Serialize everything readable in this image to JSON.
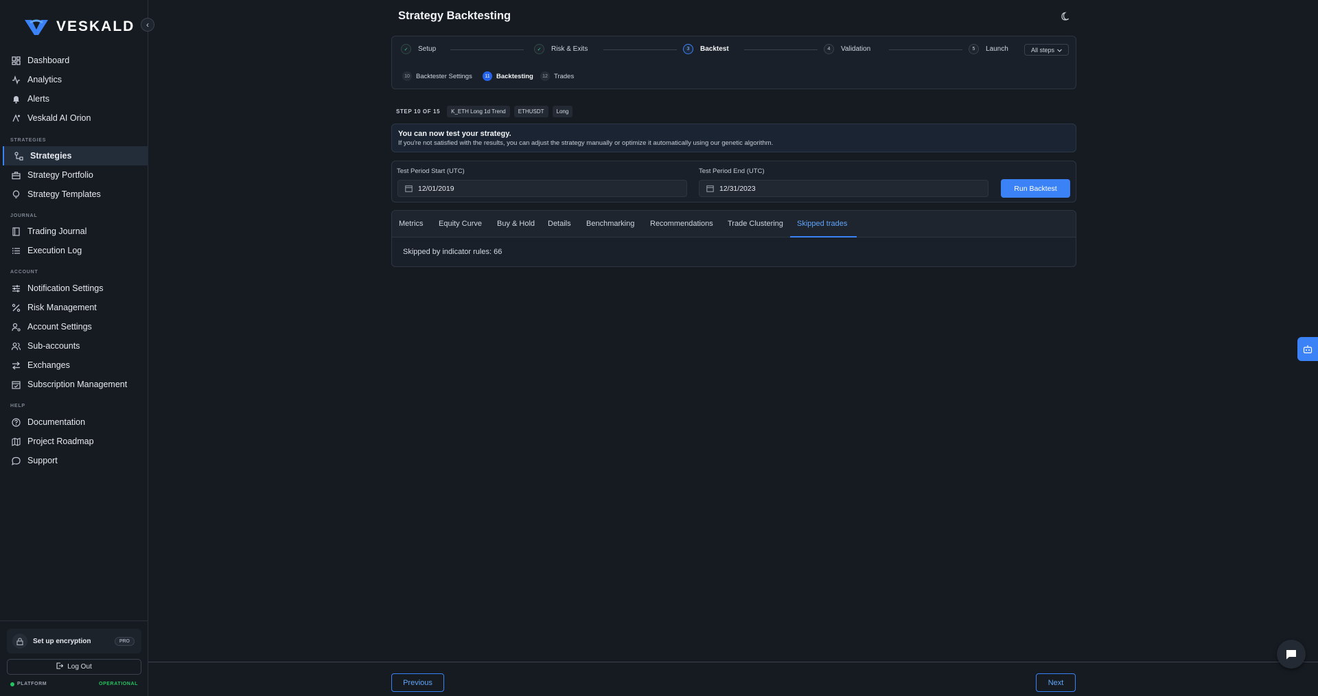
{
  "brand": {
    "name": "VESKALD"
  },
  "sidebar": {
    "top_items": [
      {
        "label": "Dashboard",
        "icon": "dashboard-icon"
      },
      {
        "label": "Analytics",
        "icon": "analytics-icon"
      },
      {
        "label": "Alerts",
        "icon": "bell-icon"
      },
      {
        "label": "Veskald AI Orion",
        "icon": "ai-icon"
      }
    ],
    "sections": [
      {
        "label": "STRATEGIES",
        "items": [
          {
            "label": "Strategies",
            "icon": "strategies-icon",
            "active": true
          },
          {
            "label": "Strategy Portfolio",
            "icon": "briefcase-icon"
          },
          {
            "label": "Strategy Templates",
            "icon": "lightbulb-icon"
          }
        ]
      },
      {
        "label": "JOURNAL",
        "items": [
          {
            "label": "Trading Journal",
            "icon": "book-icon"
          },
          {
            "label": "Execution Log",
            "icon": "list-icon"
          }
        ]
      },
      {
        "label": "ACCOUNT",
        "items": [
          {
            "label": "Notification Settings",
            "icon": "sliders-icon"
          },
          {
            "label": "Risk Management",
            "icon": "percent-icon"
          },
          {
            "label": "Account Settings",
            "icon": "user-gear-icon"
          },
          {
            "label": "Sub-accounts",
            "icon": "users-icon"
          },
          {
            "label": "Exchanges",
            "icon": "swap-icon"
          },
          {
            "label": "Subscription Management",
            "icon": "calendar-check-icon"
          }
        ]
      },
      {
        "label": "HELP",
        "items": [
          {
            "label": "Documentation",
            "icon": "help-circle-icon"
          },
          {
            "label": "Project Roadmap",
            "icon": "map-icon"
          },
          {
            "label": "Support",
            "icon": "chat-icon"
          }
        ]
      }
    ],
    "encryption": {
      "label": "Set up encryption",
      "badge": "PRO"
    },
    "logout_label": "Log Out",
    "platform_label": "PLATFORM",
    "platform_status": "OPERATIONAL"
  },
  "header": {
    "title": "Strategy Backtesting"
  },
  "stepper": {
    "steps": [
      {
        "num": "✓",
        "label": "Setup",
        "state": "done"
      },
      {
        "num": "✓",
        "label": "Risk & Exits",
        "state": "done"
      },
      {
        "num": "3",
        "label": "Backtest",
        "state": "current"
      },
      {
        "num": "4",
        "label": "Validation",
        "state": "todo"
      },
      {
        "num": "5",
        "label": "Launch",
        "state": "todo"
      }
    ],
    "all_steps_label": "All steps",
    "substeps": [
      {
        "num": "10",
        "label": "Backtester Settings",
        "state": "todo"
      },
      {
        "num": "11",
        "label": "Backtesting",
        "state": "current"
      },
      {
        "num": "12",
        "label": "Trades",
        "state": "todo"
      }
    ]
  },
  "meta": {
    "step_counter": "STEP 10 OF 15",
    "chips": [
      "K_ETH Long 1d Trend",
      "ETHUSDT",
      "Long"
    ]
  },
  "banner": {
    "title": "You can now test your strategy.",
    "text": "If you're not satisfied with the results, you can adjust the strategy manually or optimize it automatically using our genetic algorithm."
  },
  "period": {
    "start_label": "Test Period Start (UTC)",
    "start_value": "12/01/2019",
    "end_label": "Test Period End (UTC)",
    "end_value": "12/31/2023",
    "run_label": "Run Backtest"
  },
  "tabs": {
    "items": [
      "Metrics",
      "Equity Curve",
      "Buy & Hold",
      "Details",
      "Benchmarking",
      "Recommendations",
      "Trade Clustering",
      "Skipped trades"
    ],
    "active": "Skipped trades",
    "content_text": "Skipped by indicator rules: 66"
  },
  "footer": {
    "previous_label": "Previous",
    "next_label": "Next"
  },
  "colors": {
    "accent": "#3b82f6",
    "background": "#161b22",
    "success": "#22c55e"
  }
}
